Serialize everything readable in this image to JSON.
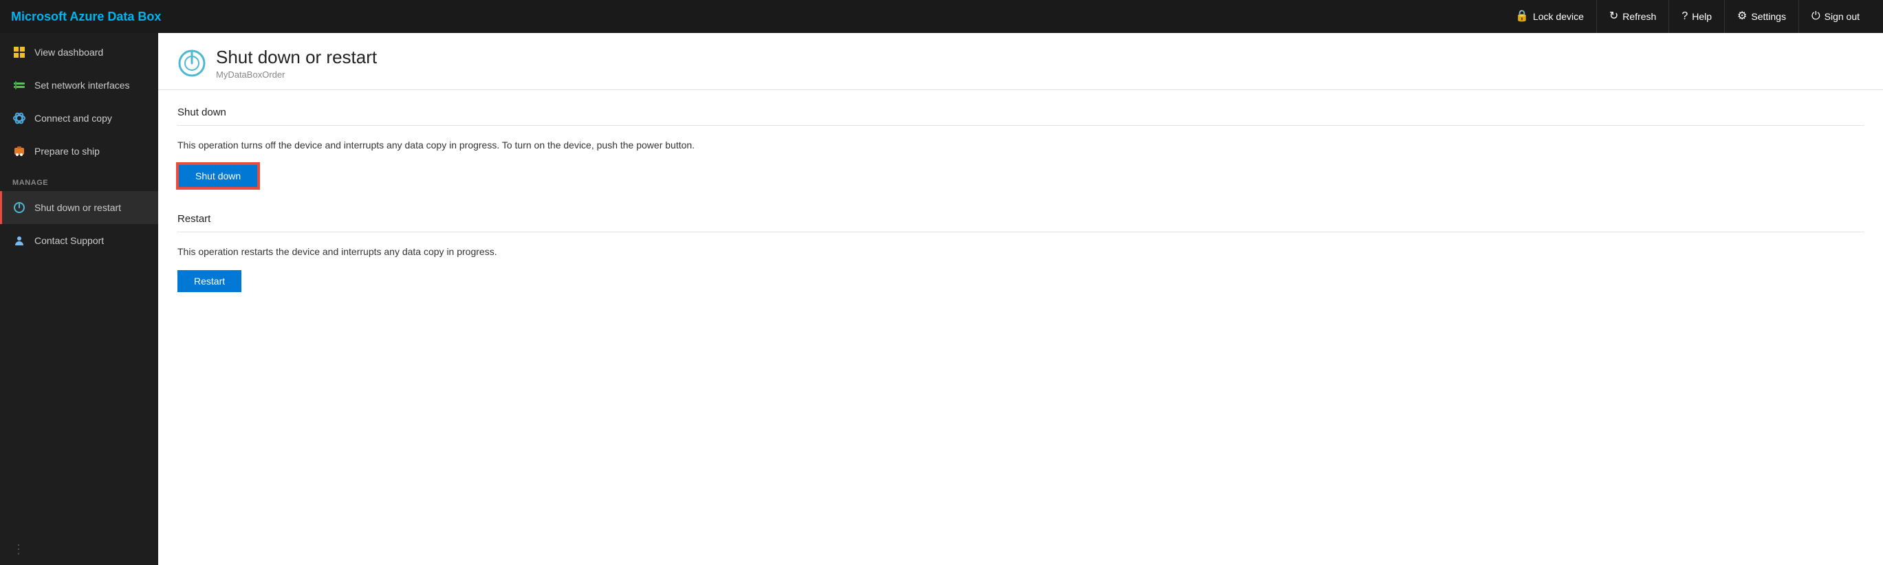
{
  "brand": "Microsoft Azure Data Box",
  "topnav": {
    "lock_label": "Lock device",
    "refresh_label": "Refresh",
    "help_label": "Help",
    "settings_label": "Settings",
    "signout_label": "Sign out"
  },
  "sidebar": {
    "items": [
      {
        "id": "view-dashboard",
        "label": "View dashboard",
        "icon": "dashboard",
        "active": false
      },
      {
        "id": "set-network",
        "label": "Set network interfaces",
        "icon": "network",
        "active": false
      },
      {
        "id": "connect-copy",
        "label": "Connect and copy",
        "icon": "copy",
        "active": false
      },
      {
        "id": "prepare-ship",
        "label": "Prepare to ship",
        "icon": "ship",
        "active": false
      }
    ],
    "manage_label": "MANAGE",
    "manage_items": [
      {
        "id": "shut-down-restart",
        "label": "Shut down or restart",
        "icon": "shutdown",
        "active": true
      },
      {
        "id": "contact-support",
        "label": "Contact Support",
        "icon": "support",
        "active": false
      }
    ],
    "drag_handle": "⋮"
  },
  "page": {
    "title": "Shut down or restart",
    "subtitle": "MyDataBoxOrder",
    "sections": [
      {
        "id": "shutdown",
        "title": "Shut down",
        "description": "This operation turns off the device and interrupts any data copy in progress. To turn on the device, push the power button.",
        "button_label": "Shut down",
        "highlighted": true
      },
      {
        "id": "restart",
        "title": "Restart",
        "description": "This operation restarts the device and interrupts any data copy in progress.",
        "button_label": "Restart",
        "highlighted": false
      }
    ]
  }
}
